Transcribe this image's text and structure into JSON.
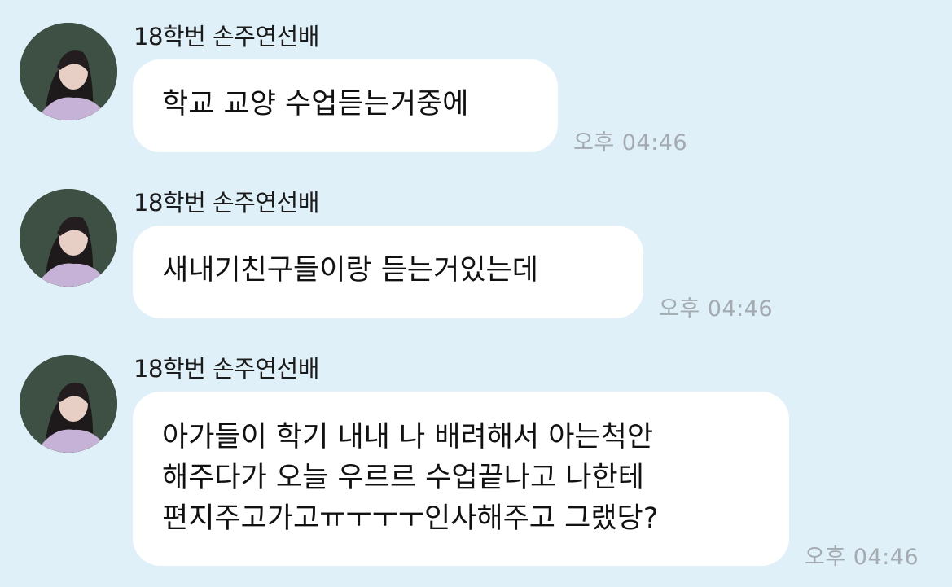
{
  "messages": [
    {
      "sender": "18학번 손주연선배",
      "lines": [
        "학교 교양 수업듣는거중에"
      ],
      "time": "오후 04:46"
    },
    {
      "sender": "18학번 손주연선배",
      "lines": [
        "새내기친구들이랑 듣는거있는데"
      ],
      "time": "오후 04:46"
    },
    {
      "sender": "18학번 손주연선배",
      "lines": [
        "아가들이 학기 내내 나 배려해서 아는척안",
        "해주다가 오늘 우르르 수업끝나고 나한테",
        "편지주고가고ㅠㅜㅜㅜ인사해주고 그랬당?"
      ],
      "time": "오후 04:46"
    }
  ],
  "colors": {
    "background": "#dff0f8",
    "bubble": "#ffffff",
    "timestamp": "#a3aab0"
  }
}
